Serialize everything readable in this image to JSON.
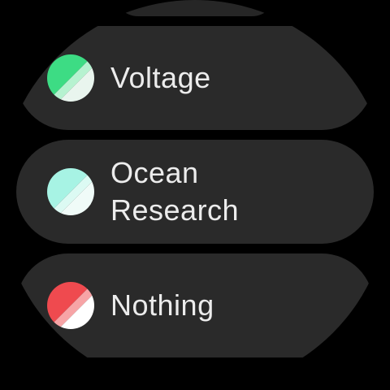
{
  "theme_list": {
    "items": [
      {
        "label": "Voltage",
        "icon": "theme-swatch-icon",
        "colors": {
          "primary": "#3ddc84",
          "stripe": "#b6f2d0",
          "secondary": "#e9f5ee"
        }
      },
      {
        "label": "Ocean\nResearch",
        "icon": "theme-swatch-icon",
        "colors": {
          "primary": "#a7f3e4",
          "stripe": "#dcfaf3",
          "secondary": "#f0fbf8"
        }
      },
      {
        "label": "Nothing",
        "icon": "theme-swatch-icon",
        "colors": {
          "primary": "#ef4a4f",
          "stripe": "#f7a4a6",
          "secondary": "#ffffff"
        }
      }
    ]
  }
}
